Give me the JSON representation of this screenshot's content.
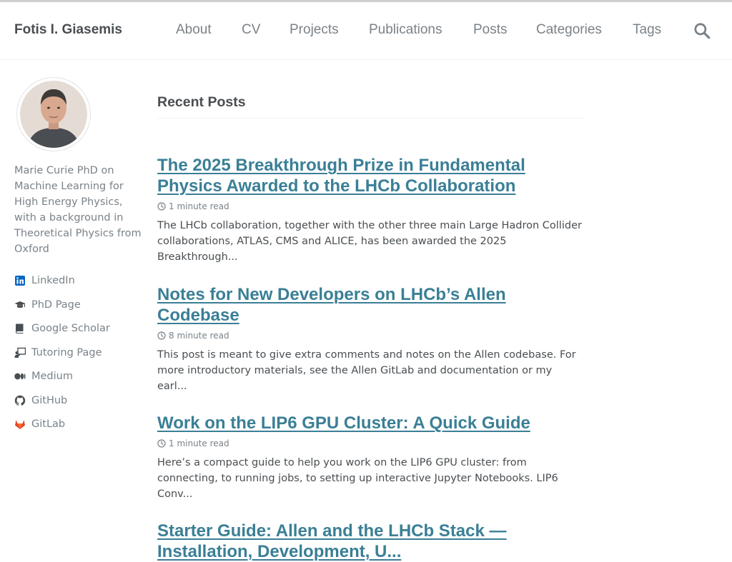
{
  "site": {
    "title": "Fotis I. Giasemis"
  },
  "nav": {
    "items": [
      {
        "label": "About"
      },
      {
        "label": "CV"
      },
      {
        "label": "Projects"
      },
      {
        "label": "Publications"
      },
      {
        "label": "Posts"
      },
      {
        "label": "Categories"
      },
      {
        "label": "Tags"
      }
    ],
    "search_icon": "search-icon"
  },
  "author": {
    "bio": "Marie Curie PhD on Machine Learning for High Energy Physics, with a background in Theoretical Physics from Oxford",
    "links": [
      {
        "label": "LinkedIn",
        "icon": "linkedin-icon",
        "color": "#0a66c2"
      },
      {
        "label": "PhD Page",
        "icon": "graduation-cap-icon",
        "color": "#494e52"
      },
      {
        "label": "Google Scholar",
        "icon": "book-icon",
        "color": "#494e52"
      },
      {
        "label": "Tutoring Page",
        "icon": "chalkboard-teacher-icon",
        "color": "#494e52"
      },
      {
        "label": "Medium",
        "icon": "medium-icon",
        "color": "#494e52"
      },
      {
        "label": "GitHub",
        "icon": "github-icon",
        "color": "#494e52"
      },
      {
        "label": "GitLab",
        "icon": "gitlab-icon",
        "color": "#e2432a"
      }
    ]
  },
  "main": {
    "title": "Recent Posts",
    "posts": [
      {
        "title_line1": "The 2025 Breakthrough Prize in Fundamental",
        "title_line2": "Physics Awarded to the LHCb Collaboration",
        "read_time": "1 minute read",
        "excerpt": "The LHCb collaboration, together with the other three main Large Hadron Collider collaborations, ATLAS, CMS and ALICE, has been awarded the 2025 Breakthrough..."
      },
      {
        "title_line1": "Notes for New Developers on LHCb’s Allen",
        "title_line2": "Codebase",
        "read_time": "8 minute read",
        "excerpt": "This post is meant to give extra comments and notes on the Allen codebase. For more introductory materials, see the Allen GitLab and documentation or my earl..."
      },
      {
        "title_line1": "Work on the LIP6 GPU Cluster: A Quick Guide",
        "title_line2": "",
        "read_time": "1 minute read",
        "excerpt": "Here’s a compact guide to help you work on the LIP6 GPU cluster: from connecting, to running jobs, to setting up interactive Jupyter Notebooks. LIP6 Conv..."
      },
      {
        "title_line1": "Starter Guide: Allen and the LHCb Stack —",
        "title_line2": "Installation, Development, U...",
        "read_time": "",
        "excerpt": ""
      }
    ]
  },
  "colors": {
    "link": "#3a7f96",
    "text": "#494e52",
    "muted": "#7a8288"
  }
}
